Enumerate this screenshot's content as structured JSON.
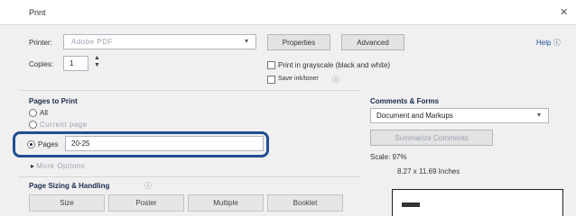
{
  "window": {
    "title": "Print",
    "close_icon": "close-icon"
  },
  "printer": {
    "label": "Printer:",
    "value": "Adobe PDF",
    "properties_label": "Properties",
    "advanced_label": "Advanced",
    "help_label": "Help"
  },
  "copies": {
    "label": "Copies:",
    "value": "1"
  },
  "options": {
    "grayscale_label": "Print in grayscale (black and white)",
    "save_ink_label": "Save ink/toner"
  },
  "pages_to_print": {
    "heading": "Pages to Print",
    "all_label": "All",
    "current_label": "Current page",
    "pages_label": "Pages",
    "pages_value": "20-25",
    "more_options_label": "More Options"
  },
  "sizing": {
    "heading": "Page Sizing & Handling",
    "tabs": [
      "Size",
      "Poster",
      "Multiple",
      "Booklet"
    ]
  },
  "comments": {
    "heading": "Comments & Forms",
    "select_value": "Document and Markups",
    "summarize_label": "Summarize Comments"
  },
  "preview": {
    "scale_label": "Scale: 97%",
    "size_label": "8.27 x 11.69 Inches"
  }
}
